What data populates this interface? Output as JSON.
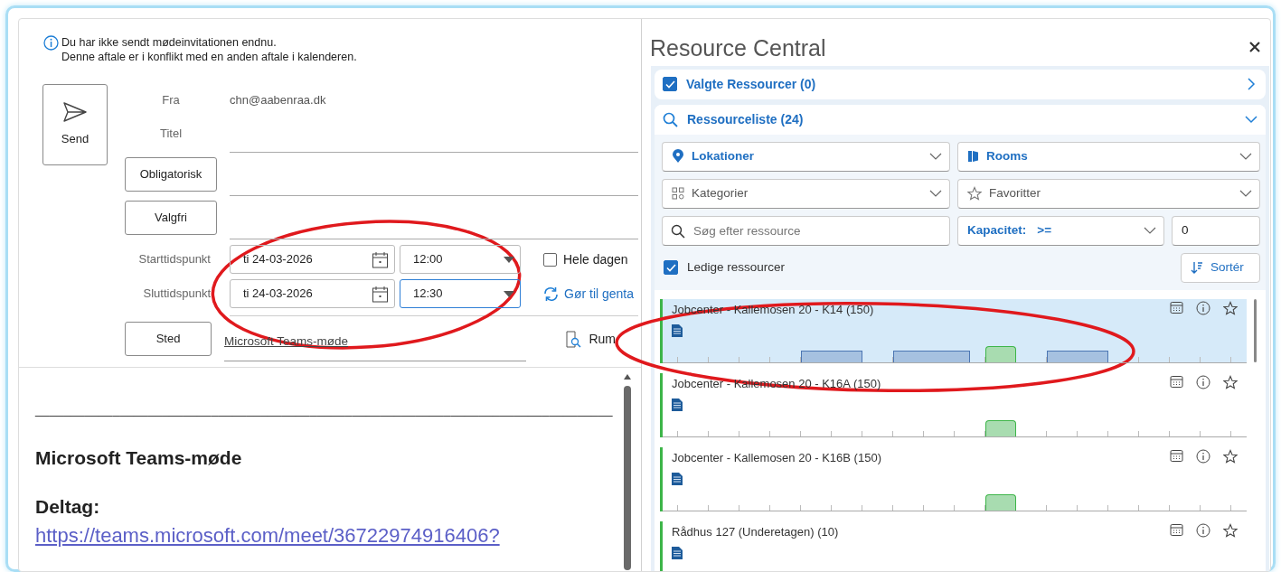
{
  "info_banner": {
    "lines": [
      "Du har ikke sendt mødeinvitationen endnu.",
      "Denne aftale er i konflikt med en anden aftale i kalenderen."
    ]
  },
  "send_button": {
    "label": "Send"
  },
  "from": {
    "label": "Fra",
    "value": "chn@aabenraa.dk"
  },
  "title_field": {
    "label": "Titel"
  },
  "attendee_buttons": [
    "Obligatorisk",
    "Valgfri"
  ],
  "times": [
    {
      "label": "Starttidspunkt",
      "date": "ti 24-03-2026",
      "time": "12:00",
      "focused": false
    },
    {
      "label": "Sluttidspunkt",
      "date": "ti 24-03-2026",
      "time": "12:30",
      "focused": true
    }
  ],
  "all_day": {
    "label": "Hele dagen",
    "checked": false
  },
  "recurrence": {
    "label": "Gør til genta"
  },
  "location": {
    "button": "Sted",
    "value": "Microsoft Teams-møde",
    "rooms_button": "Rum"
  },
  "body": {
    "rule": "__________________________________________________________________________________",
    "heading": "Microsoft Teams-møde",
    "join_label": "Deltag:",
    "link": "https://teams.microsoft.com/meet/36722974916406?"
  },
  "resource_central": {
    "title": "Resource Central",
    "selected_section": {
      "label": "Valgte Ressourcer (0)",
      "checked": true,
      "expanded": false
    },
    "list_section": {
      "label": "Ressourceliste (24)",
      "expanded": true
    },
    "filters": [
      {
        "label": "Lokationer",
        "active": true
      },
      {
        "label": "Rooms",
        "active": true
      },
      {
        "label": "Kategorier",
        "active": false
      },
      {
        "label": "Favoritter",
        "active": false
      }
    ],
    "search": {
      "placeholder": "Søg efter ressource"
    },
    "capacity": {
      "label": "Kapacitet:",
      "operator": ">=",
      "value": "0"
    },
    "available": {
      "label": "Ledige ressourcer",
      "checked": true
    },
    "sort_button": "Sortér",
    "resources": [
      {
        "name": "Jobcenter - Kallemosen 20 - K14 (150)",
        "selected": true,
        "timeline": [
          {
            "kind": "free"
          },
          {
            "kind": "free"
          },
          {
            "kind": "free"
          },
          {
            "kind": "free"
          },
          {
            "kind": "free"
          },
          {
            "kind": "free"
          },
          {
            "kind": "free"
          },
          {
            "kind": "free"
          },
          {
            "kind": "free"
          },
          {
            "kind": "busy"
          },
          {
            "kind": "busy"
          },
          {
            "kind": "busy"
          },
          {
            "kind": "busy"
          },
          {
            "kind": "free"
          },
          {
            "kind": "free"
          },
          {
            "kind": "busy"
          },
          {
            "kind": "busy"
          },
          {
            "kind": "busy"
          },
          {
            "kind": "busy"
          },
          {
            "kind": "busy"
          },
          {
            "kind": "free"
          },
          {
            "kind": "proposed"
          },
          {
            "kind": "proposed"
          },
          {
            "kind": "free"
          },
          {
            "kind": "free"
          },
          {
            "kind": "busy"
          },
          {
            "kind": "busy"
          },
          {
            "kind": "busy"
          },
          {
            "kind": "busy"
          },
          {
            "kind": "free"
          },
          {
            "kind": "free"
          },
          {
            "kind": "free"
          },
          {
            "kind": "free"
          },
          {
            "kind": "free"
          },
          {
            "kind": "free"
          },
          {
            "kind": "free"
          },
          {
            "kind": "free"
          },
          {
            "kind": "free"
          }
        ]
      },
      {
        "name": "Jobcenter - Kallemosen 20 - K16A (150)",
        "selected": false,
        "timeline": [
          {
            "kind": "free"
          },
          {
            "kind": "free"
          },
          {
            "kind": "free"
          },
          {
            "kind": "free"
          },
          {
            "kind": "free"
          },
          {
            "kind": "free"
          },
          {
            "kind": "free"
          },
          {
            "kind": "free"
          },
          {
            "kind": "free"
          },
          {
            "kind": "free"
          },
          {
            "kind": "free"
          },
          {
            "kind": "free"
          },
          {
            "kind": "free"
          },
          {
            "kind": "free"
          },
          {
            "kind": "free"
          },
          {
            "kind": "free"
          },
          {
            "kind": "free"
          },
          {
            "kind": "free"
          },
          {
            "kind": "free"
          },
          {
            "kind": "free"
          },
          {
            "kind": "free"
          },
          {
            "kind": "proposed"
          },
          {
            "kind": "proposed"
          },
          {
            "kind": "free"
          },
          {
            "kind": "free"
          },
          {
            "kind": "free"
          },
          {
            "kind": "free"
          },
          {
            "kind": "free"
          },
          {
            "kind": "free"
          },
          {
            "kind": "free"
          },
          {
            "kind": "free"
          },
          {
            "kind": "free"
          },
          {
            "kind": "free"
          },
          {
            "kind": "free"
          },
          {
            "kind": "free"
          },
          {
            "kind": "free"
          },
          {
            "kind": "free"
          },
          {
            "kind": "free"
          }
        ]
      },
      {
        "name": "Jobcenter - Kallemosen 20 - K16B (150)",
        "selected": false,
        "timeline": [
          {
            "kind": "free"
          },
          {
            "kind": "free"
          },
          {
            "kind": "free"
          },
          {
            "kind": "free"
          },
          {
            "kind": "free"
          },
          {
            "kind": "free"
          },
          {
            "kind": "free"
          },
          {
            "kind": "free"
          },
          {
            "kind": "free"
          },
          {
            "kind": "free"
          },
          {
            "kind": "free"
          },
          {
            "kind": "free"
          },
          {
            "kind": "free"
          },
          {
            "kind": "free"
          },
          {
            "kind": "free"
          },
          {
            "kind": "free"
          },
          {
            "kind": "free"
          },
          {
            "kind": "free"
          },
          {
            "kind": "free"
          },
          {
            "kind": "free"
          },
          {
            "kind": "free"
          },
          {
            "kind": "proposed"
          },
          {
            "kind": "proposed"
          },
          {
            "kind": "free"
          },
          {
            "kind": "free"
          },
          {
            "kind": "free"
          },
          {
            "kind": "free"
          },
          {
            "kind": "free"
          },
          {
            "kind": "free"
          },
          {
            "kind": "free"
          },
          {
            "kind": "free"
          },
          {
            "kind": "free"
          },
          {
            "kind": "free"
          },
          {
            "kind": "free"
          },
          {
            "kind": "free"
          },
          {
            "kind": "free"
          },
          {
            "kind": "free"
          },
          {
            "kind": "free"
          }
        ]
      },
      {
        "name": "Rådhus 127 (Underetagen) (10)",
        "selected": false
      }
    ]
  },
  "annotations": [
    {
      "kind": "ellipse"
    },
    {
      "kind": "ellipse"
    }
  ]
}
